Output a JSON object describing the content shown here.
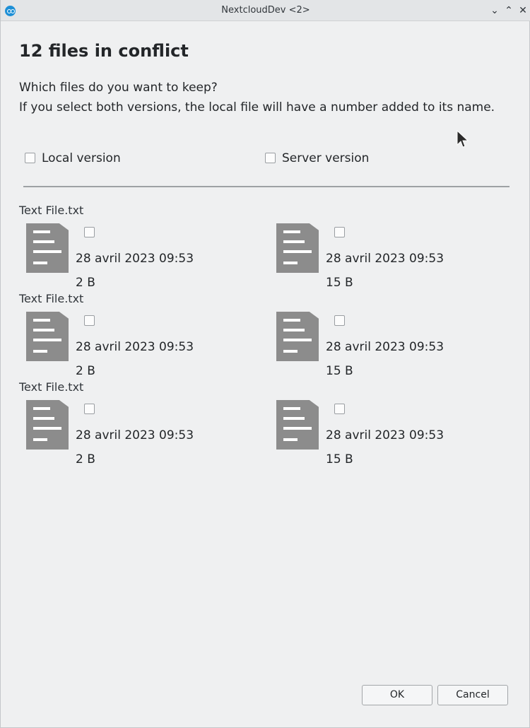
{
  "window": {
    "title": "NextcloudDev <2>",
    "minimize_glyph": "⌄",
    "maximize_glyph": "⌃",
    "close_glyph": "✕"
  },
  "dialog": {
    "heading": "12 files in conflict",
    "question": "Which files do you want to keep?",
    "hint": "If you select both versions, the local file will have a number added to its name.",
    "local_version_label": "Local version",
    "server_version_label": "Server version"
  },
  "conflicts": [
    {
      "file_name": "Text File.txt",
      "local": {
        "date": "28 avril 2023 09:53",
        "size": "2 B",
        "checked": false
      },
      "server": {
        "date": "28 avril 2023 09:53",
        "size": "15 B",
        "checked": false
      }
    },
    {
      "file_name": "Text File.txt",
      "local": {
        "date": "28 avril 2023 09:53",
        "size": "2 B",
        "checked": false
      },
      "server": {
        "date": "28 avril 2023 09:53",
        "size": "15 B",
        "checked": false
      }
    },
    {
      "file_name": "Text File.txt",
      "local": {
        "date": "28 avril 2023 09:53",
        "size": "2 B",
        "checked": false
      },
      "server": {
        "date": "28 avril 2023 09:53",
        "size": "15 B",
        "checked": false
      }
    }
  ],
  "buttons": {
    "ok_label": "OK",
    "cancel_label": "Cancel"
  },
  "colors": {
    "accent": "#1d8fd6",
    "file_icon": "#8c8c8c"
  }
}
